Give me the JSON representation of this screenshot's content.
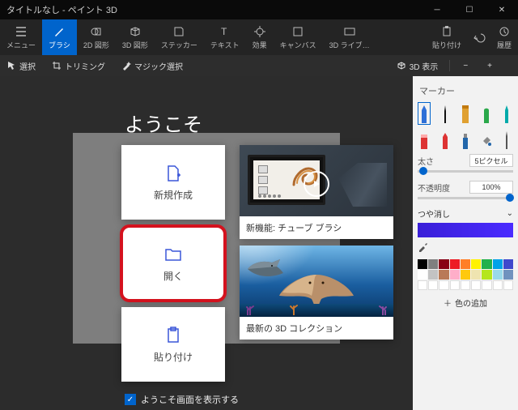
{
  "window": {
    "title": "タイトルなし - ペイント 3D"
  },
  "ribbon": {
    "menu": "メニュー",
    "brush": "ブラシ",
    "shape2d": "2D 図形",
    "shape3d": "3D 図形",
    "sticker": "ステッカー",
    "text": "テキスト",
    "effect": "効果",
    "canvas": "キャンバス",
    "lib3d": "3D ライブ…",
    "paste": "貼り付け",
    "undo": "元に戻す",
    "history": "履歴"
  },
  "toolbar": {
    "select": "選択",
    "trim": "トリミング",
    "magic": "マジック選択",
    "view3d": "3D 表示"
  },
  "panel": {
    "title": "マーカー",
    "thickness_label": "太さ",
    "thickness_value": "5ピクセル",
    "opacity_label": "不透明度",
    "opacity_value": "100%",
    "matte_label": "つや消し",
    "add_color": "色の追加",
    "swatches": [
      "#000000",
      "#7f7f7f",
      "#880015",
      "#ed1c24",
      "#ff7f27",
      "#fff200",
      "#22b14c",
      "#00a2e8",
      "#3f48cc",
      "#ffffff",
      "#c3c3c3",
      "#b97a57",
      "#ffaec9",
      "#ffc90e",
      "#efe4b0",
      "#b5e61d",
      "#99d9ea",
      "#7092be"
    ]
  },
  "welcome": {
    "title": "ようこそ",
    "new": "新規作成",
    "open": "開く",
    "paste": "貼り付け",
    "tile1_caption": "新機能: チューブ ブラシ",
    "tile2_caption": "最新の 3D コレクション",
    "show_label": "ようこそ画面を表示する"
  }
}
